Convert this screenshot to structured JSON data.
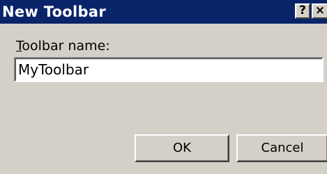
{
  "window": {
    "title": "New Toolbar",
    "help_button": "?",
    "close_button": "×"
  },
  "form": {
    "label_accel": "T",
    "label_rest": "oolbar name:",
    "toolbar_name_value": "MyToolbar"
  },
  "buttons": {
    "ok": "OK",
    "cancel": "Cancel"
  },
  "colors": {
    "titlebar": "#0a246a",
    "dialog_bg": "#d4d0c8"
  }
}
